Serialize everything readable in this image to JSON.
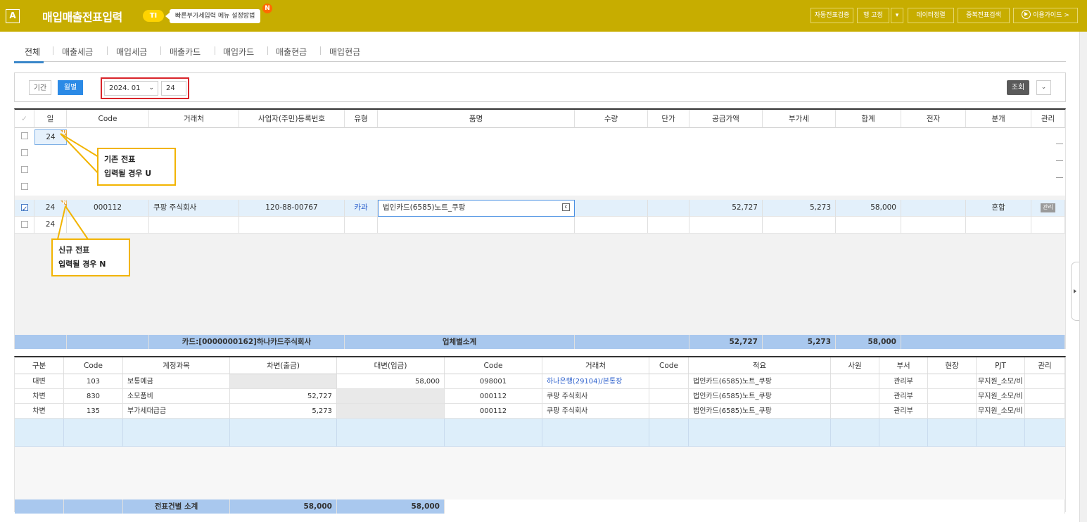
{
  "header": {
    "app_icon": "A",
    "title": "매입매출전표입력",
    "badge": "TI",
    "quick_guide": "빠른부가세입력 메뉴 설정방법",
    "new_dot": "N",
    "buttons": [
      "자동전표검증",
      "행 고정",
      "데이터정렬",
      "중복전표검색",
      "이용가이드 >"
    ],
    "pin_toggle": "▾",
    "accent_color": "#c7ad00"
  },
  "tabs": [
    "전체",
    "매출세금",
    "매입세금",
    "매출카드",
    "매입카드",
    "매출현금",
    "매입현금"
  ],
  "filter": {
    "period_label": "기간",
    "month_label": "월별",
    "month_value": "2024. 01",
    "day_value": "24",
    "search_label": "조회",
    "more_icon": "chevron-down-icon"
  },
  "upper_grid": {
    "headers": [
      "✓",
      "일",
      "Code",
      "거래처",
      "사업자(주민)등록번호",
      "유형",
      "품명",
      "수량",
      "단가",
      "공급가액",
      "부가세",
      "합계",
      "전자",
      "분개",
      "관리"
    ],
    "rows": [
      {
        "day": "24",
        "flag": "U",
        "checked": false
      },
      {
        "day": "",
        "flag": "",
        "checked": false
      },
      {
        "day": "",
        "flag": "",
        "checked": false
      },
      {
        "day": "",
        "flag": "",
        "checked": false
      },
      {
        "day": "24",
        "flag": "N",
        "checked": true,
        "code": "000112",
        "vendor": "쿠팡 주식회사",
        "bizno": "120-88-00767",
        "type": "카과",
        "item": "법인카드(6585)노트_쿠팡",
        "supply": "52,727",
        "vat": "5,273",
        "total": "58,000",
        "journal": "혼합",
        "manage": "관리"
      },
      {
        "day": "24",
        "flag": "",
        "checked": false
      }
    ],
    "subtotal": {
      "card": "카드:[0000000162]하나카드주식회사",
      "label": "업체별소계",
      "supply": "52,727",
      "vat": "5,273",
      "total": "58,000"
    }
  },
  "annotations": {
    "existing": [
      "기존 전표",
      "입력될 경우 U"
    ],
    "new": [
      "신규 전표",
      "입력될 경우 N"
    ]
  },
  "lower_grid": {
    "headers": [
      "구분",
      "Code",
      "계정과목",
      "차변(출금)",
      "대변(입금)",
      "Code",
      "거래처",
      "Code",
      "적요",
      "사원",
      "부서",
      "현장",
      "PJT",
      "관리"
    ],
    "rows": [
      {
        "kind": "대변",
        "code": "103",
        "account": "보통예금",
        "debit": "",
        "credit": "58,000",
        "vcode": "098001",
        "vendor": "하나은행(29104)/본통장",
        "memo": "법인카드(6585)노트_쿠팡",
        "dept": "관리부",
        "pjt": "무지원_소모/비"
      },
      {
        "kind": "차변",
        "code": "830",
        "account": "소모품비",
        "debit": "52,727",
        "credit": "",
        "vcode": "000112",
        "vendor": "쿠팡 주식회사",
        "memo": "법인카드(6585)노트_쿠팡",
        "dept": "관리부",
        "pjt": "무지원_소모/비"
      },
      {
        "kind": "차변",
        "code": "135",
        "account": "부가세대급금",
        "debit": "5,273",
        "credit": "",
        "vcode": "000112",
        "vendor": "쿠팡 주식회사",
        "memo": "법인카드(6585)노트_쿠팡",
        "dept": "관리부",
        "pjt": "무지원_소모/비"
      }
    ],
    "subtotal": {
      "label": "전표건별 소계",
      "debit": "58,000",
      "credit": "58,000"
    }
  }
}
